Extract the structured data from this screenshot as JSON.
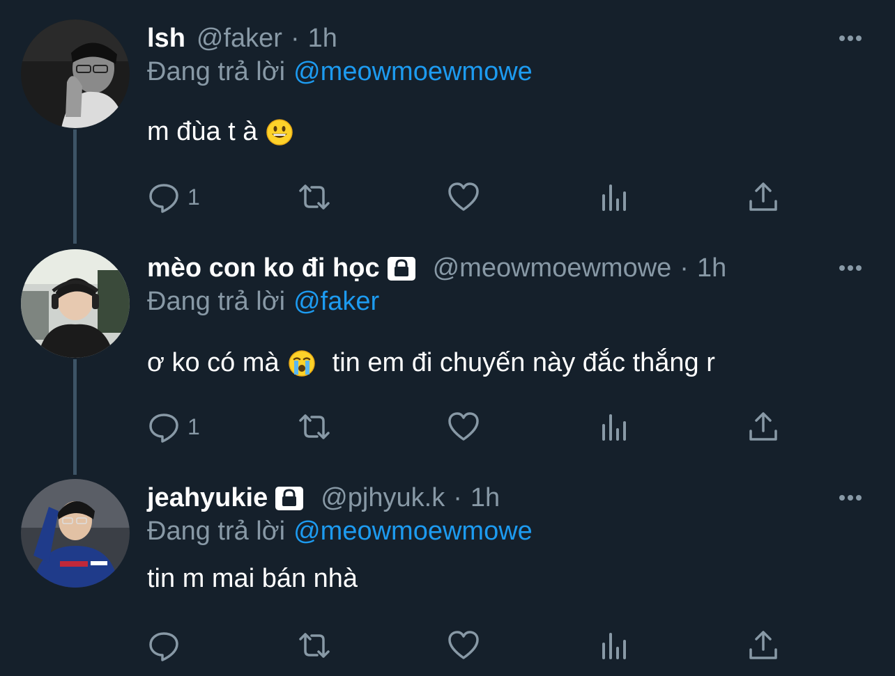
{
  "colors": {
    "background": "#15202b",
    "secondary_text": "#8899a6",
    "mention": "#1d9bf0",
    "thread_line": "#3d5466"
  },
  "tweets": [
    {
      "name": "lsh",
      "locked": false,
      "handle": "@faker",
      "separator": "·",
      "time": "1h",
      "reply_prefix": "Đang trả lời",
      "reply_to": "@meowmoewmowe",
      "text": "m đùa t à",
      "emoji": "grinning-face-emoji",
      "reply_count": "1",
      "icons": [
        "reply-icon",
        "retweet-icon",
        "like-icon",
        "analytics-icon",
        "share-icon",
        "more-icon"
      ]
    },
    {
      "name": "mèo con ko đi học",
      "locked": true,
      "handle": "@meowmoewmowe",
      "separator": "·",
      "time": "1h",
      "reply_prefix": "Đang trả lời",
      "reply_to": "@faker",
      "text_before": "ơ ko có mà",
      "text_after": "tin em đi chuyến này đắc thắng r",
      "emoji": "loudly-crying-face-emoji",
      "reply_count": "1",
      "icons": [
        "reply-icon",
        "retweet-icon",
        "like-icon",
        "analytics-icon",
        "share-icon",
        "more-icon"
      ]
    },
    {
      "name": "jeahyukie",
      "locked": true,
      "handle": "@pjhyuk.k",
      "separator": "·",
      "time": "1h",
      "reply_prefix": "Đang trả lời",
      "reply_to": "@meowmoewmowe",
      "text": "tin m mai bán nhà",
      "reply_count": "",
      "icons": [
        "reply-icon",
        "retweet-icon",
        "like-icon",
        "analytics-icon",
        "share-icon",
        "more-icon"
      ]
    }
  ]
}
